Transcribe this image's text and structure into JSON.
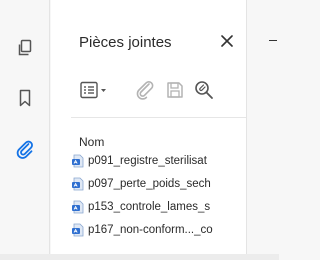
{
  "panel": {
    "title": "Pièces jointes",
    "column_header": "Nom"
  },
  "rail": {
    "items": [
      {
        "name": "pages",
        "icon": "pages-icon"
      },
      {
        "name": "bookmarks",
        "icon": "bookmark-icon"
      },
      {
        "name": "attachments",
        "icon": "paperclip-icon",
        "active": true
      }
    ]
  },
  "toolbar": {
    "options_icon": "list-options-icon",
    "open_icon": "open-attachment-icon",
    "save_icon": "save-attachment-icon",
    "search_icon": "search-attachment-icon"
  },
  "files": [
    {
      "name": "p091_registre_sterilisat"
    },
    {
      "name": "p097_perte_poids_sech"
    },
    {
      "name": "p153_controle_lames_s"
    },
    {
      "name": "p167_non-conform..._co"
    }
  ],
  "colors": {
    "accent": "#1473e6",
    "icon_gray": "#6e6e6e",
    "disabled_gray": "#b3b3b3"
  }
}
